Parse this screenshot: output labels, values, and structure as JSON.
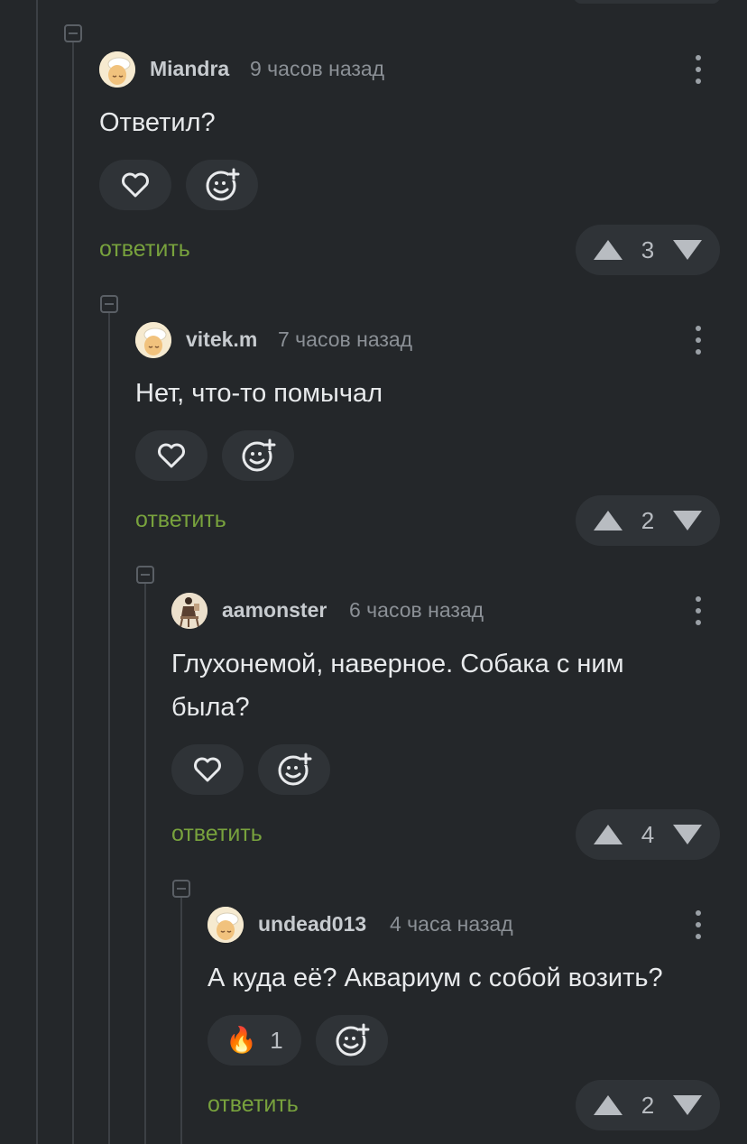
{
  "comments": [
    {
      "username": "Miandra",
      "time": "9 часов назад",
      "text": "Ответил?",
      "reply_label": "ответить",
      "rating": "3",
      "avatar": "egg-chef-avatar"
    },
    {
      "username": "vitek.m",
      "time": "7 часов назад",
      "text": "Нет, что-то помычал",
      "reply_label": "ответить",
      "rating": "2",
      "avatar": "egg-chef-avatar"
    },
    {
      "username": "aamonster",
      "time": "6 часов назад",
      "text": "Глухонемой, наверное. Собака с ним была?",
      "reply_label": "ответить",
      "rating": "4",
      "avatar": "figure-photo-avatar"
    },
    {
      "username": "undead013",
      "time": "4 часа назад",
      "text": "А куда её? Аквариум с собой возить?",
      "reply_label": "ответить",
      "rating": "2",
      "avatar": "egg-chef-avatar",
      "reaction": {
        "emoji": "🔥",
        "count": "1"
      }
    }
  ],
  "colors": {
    "background": "#24272a",
    "pill": "#2f3337",
    "reply_green": "#78a23d",
    "thread_line": "#3c4045"
  },
  "icons": [
    "heart-icon",
    "add-reaction-icon",
    "upvote-icon",
    "downvote-icon",
    "more-vertical-icon",
    "collapse-icon"
  ]
}
